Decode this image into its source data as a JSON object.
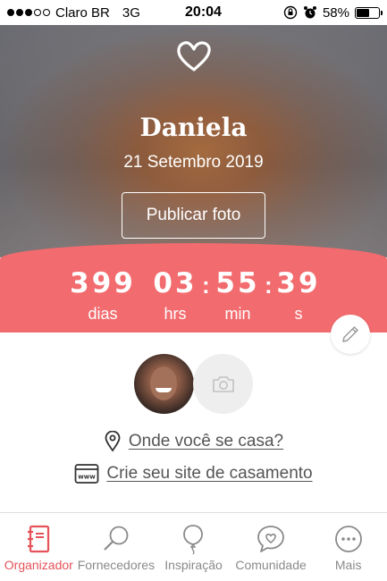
{
  "status_bar": {
    "carrier": "Claro BR",
    "network": "3G",
    "time": "20:04",
    "battery": "58%",
    "battery_level": 0.58,
    "signal_bars": 3
  },
  "hero": {
    "name": "Daniela",
    "date": "21 Setembro 2019",
    "publish_label": "Publicar foto",
    "icon": "heart-icon"
  },
  "countdown": {
    "days": "399",
    "days_label": "dias",
    "hours": "03",
    "hours_label": "hrs",
    "minutes": "55",
    "minutes_label": "min",
    "seconds": "39",
    "seconds_label": "s",
    "separator": ":"
  },
  "links": {
    "location": "Onde você se casa?",
    "website": "Crie seu site de casamento"
  },
  "tabs": [
    {
      "label": "Organizador",
      "icon": "planner-icon",
      "active": true
    },
    {
      "label": "Fornecedores",
      "icon": "search-icon",
      "active": false
    },
    {
      "label": "Inspiração",
      "icon": "balloon-icon",
      "active": false
    },
    {
      "label": "Comunidade",
      "icon": "chat-heart-icon",
      "active": false
    },
    {
      "label": "Mais",
      "icon": "more-icon",
      "active": false
    }
  ],
  "colors": {
    "accent": "#f26b6e",
    "active_tab": "#e55259",
    "inactive_tab": "#8a8a8a"
  }
}
